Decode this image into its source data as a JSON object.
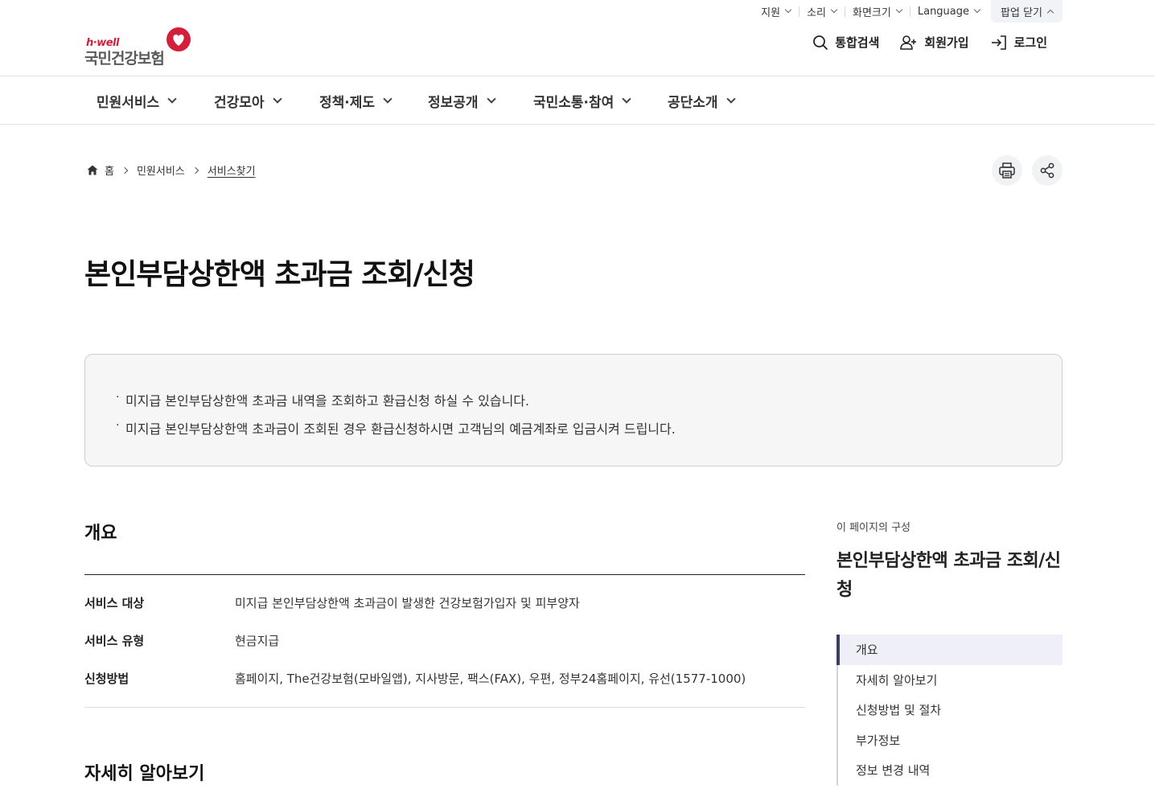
{
  "utility": {
    "items": [
      {
        "label": "지원"
      },
      {
        "label": "소리"
      },
      {
        "label": "화면크기"
      },
      {
        "label": "Language"
      }
    ],
    "popup_close": "팝업 닫기"
  },
  "logo": {
    "en": "h·well",
    "ko": "국민건강보험",
    "brand_color": "#d31f3a"
  },
  "header_links": {
    "search": "통합검색",
    "join": "회원가입",
    "login": "로그인"
  },
  "nav": {
    "items": [
      "민원서비스",
      "건강모아",
      "정책·제도",
      "정보공개",
      "국민소통·참여",
      "공단소개"
    ]
  },
  "breadcrumb": {
    "home": "홈",
    "level1": "민원서비스",
    "current": "서비스찾기"
  },
  "page": {
    "title": "본인부담상한액 초과금 조회/신청",
    "notice": [
      "미지급 본인부담상한액 초과금 내역을 조회하고 환급신청 하실 수 있습니다.",
      "미지급 본인부담상한액 초과금이 조회된 경우 환급신청하시면 고객님의 예금계좌로 입금시켜 드립니다."
    ]
  },
  "overview": {
    "heading": "개요",
    "rows": [
      {
        "label": "서비스 대상",
        "value": "미지급 본인부담상한액 초과금이 발생한 건강보험가입자 및 피부양자"
      },
      {
        "label": "서비스 유형",
        "value": "현금지급"
      },
      {
        "label": "신청방법",
        "value": "홈페이지, The건강보험(모바일앱), 지사방문, 팩스(FAX), 우편, 정부24홈페이지, 유선(1577-1000)"
      }
    ]
  },
  "detail": {
    "heading": "자세히 알아보기"
  },
  "toc": {
    "caption": "이 페이지의 구성",
    "title": "본인부담상한액 초과금 조회/신청",
    "items": [
      "개요",
      "자세히 알아보기",
      "신청방법 및 절차",
      "부가정보",
      "정보 변경 내역"
    ],
    "active_color": "#3d3f5f"
  }
}
